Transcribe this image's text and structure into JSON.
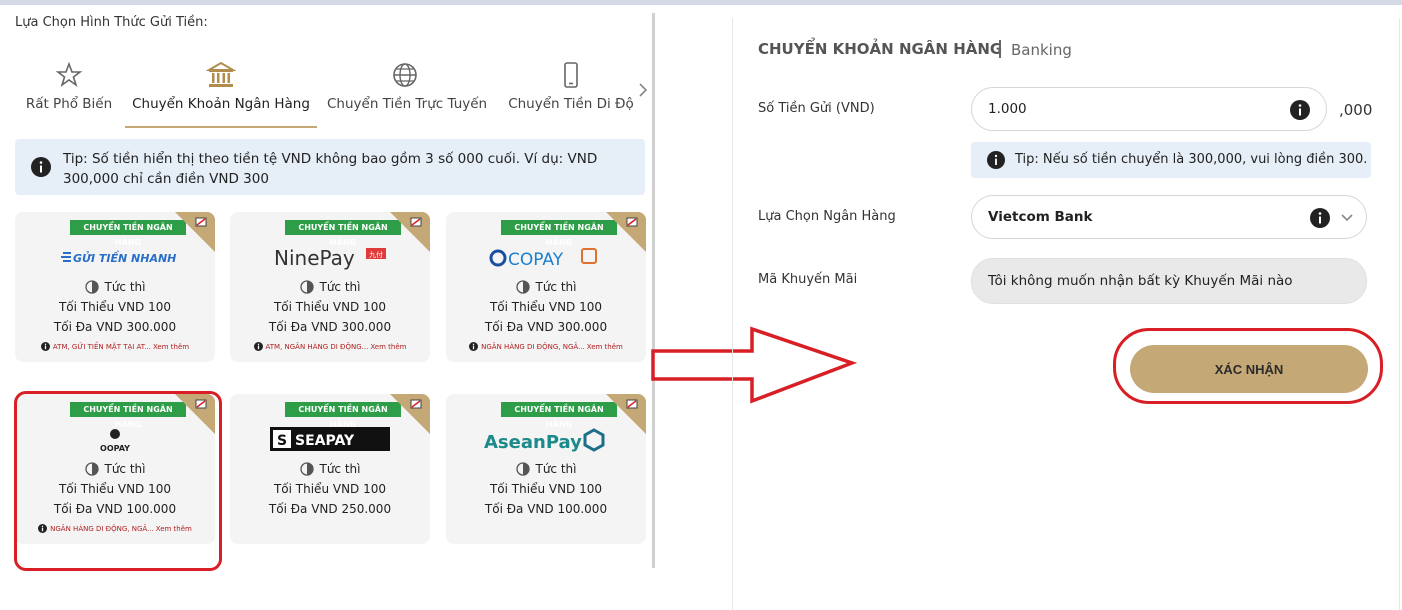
{
  "left": {
    "title": "Lựa Chọn Hình Thức Gửi Tiền:",
    "tabs": [
      {
        "label": "Rất Phổ Biến",
        "icon": "star-icon"
      },
      {
        "label": "Chuyển Khoản Ngân Hàng",
        "icon": "bank-icon",
        "active": true
      },
      {
        "label": "Chuyển Tiền Trực Tuyến",
        "icon": "globe-icon"
      },
      {
        "label": "Chuyển Tiền Di Độ",
        "icon": "mobile-icon"
      }
    ],
    "tip": "Tip: Số tiền hiển thị theo tiền tệ VND không bao gồm 3 số 000 cuối. Ví dụ: VND 300,000 chỉ cần điền VND 300",
    "cards": [
      {
        "badge": "CHUYỂN TIỀN NGÂN HÀNG",
        "logo": "GỬI TIỀN NHANH",
        "speed": "Tức thì",
        "min": "Tối Thiểu VND 100",
        "max": "Tối Đa VND 300.000",
        "note": "ATM, GỬI TIỀN MẶT TẠI AT...",
        "more": "Xem thêm"
      },
      {
        "badge": "CHUYỂN TIỀN NGÂN HÀNG",
        "logo": "NinePay",
        "logo_tag": "九付",
        "speed": "Tức thì",
        "min": "Tối Thiểu VND 100",
        "max": "Tối Đa VND 300.000",
        "note": "ATM, NGÂN HÀNG DI ĐỘNG...",
        "more": "Xem thêm"
      },
      {
        "badge": "CHUYỂN TIỀN NGÂN HÀNG",
        "logo": "COPAY",
        "speed": "Tức thì",
        "min": "Tối Thiểu VND 100",
        "max": "Tối Đa VND 300.000",
        "note": "NGÂN HÀNG DI ĐỘNG, NGÂ...",
        "more": "Xem thêm"
      },
      {
        "badge": "CHUYỂN TIỀN NGÂN HÀNG",
        "logo": "OOPAY",
        "speed": "Tức thì",
        "min": "Tối Thiểu VND 100",
        "max": "Tối Đa VND 100.000",
        "note": "NGÂN HÀNG DI ĐỘNG, NGÂ...",
        "more": "Xem thêm"
      },
      {
        "badge": "CHUYỂN TIỀN NGÂN HÀNG",
        "logo": "SEAPAY",
        "speed": "Tức thì",
        "min": "Tối Thiểu VND 100",
        "max": "Tối Đa VND 250.000"
      },
      {
        "badge": "CHUYỂN TIỀN NGÂN HÀNG",
        "logo": "AseanPay",
        "speed": "Tức thì",
        "min": "Tối Thiểu VND 100",
        "max": "Tối Đa VND 100.000"
      }
    ]
  },
  "right": {
    "title": "CHUYỂN KHOẢN NGÂN HÀNG",
    "subtitle": "Banking",
    "amount_label": "Số Tiền Gửi (VND)",
    "amount_value": "1.000",
    "amount_suffix": ",000",
    "amount_tip": "Tip: Nếu số tiền chuyển là 300,000, vui lòng điền 300.",
    "bank_label": "Lựa Chọn Ngân Hàng",
    "bank_value": "Vietcom Bank",
    "promo_label": "Mã Khuyến Mãi",
    "promo_value": "Tôi không muốn nhận bất kỳ Khuyến Mãi nào",
    "confirm": "XÁC NHẬN"
  },
  "colors": {
    "accent_gold": "#c4a876",
    "badge_green": "#2e9d47",
    "tip_bg": "#e6eef8",
    "highlight_red": "#d81f26"
  }
}
